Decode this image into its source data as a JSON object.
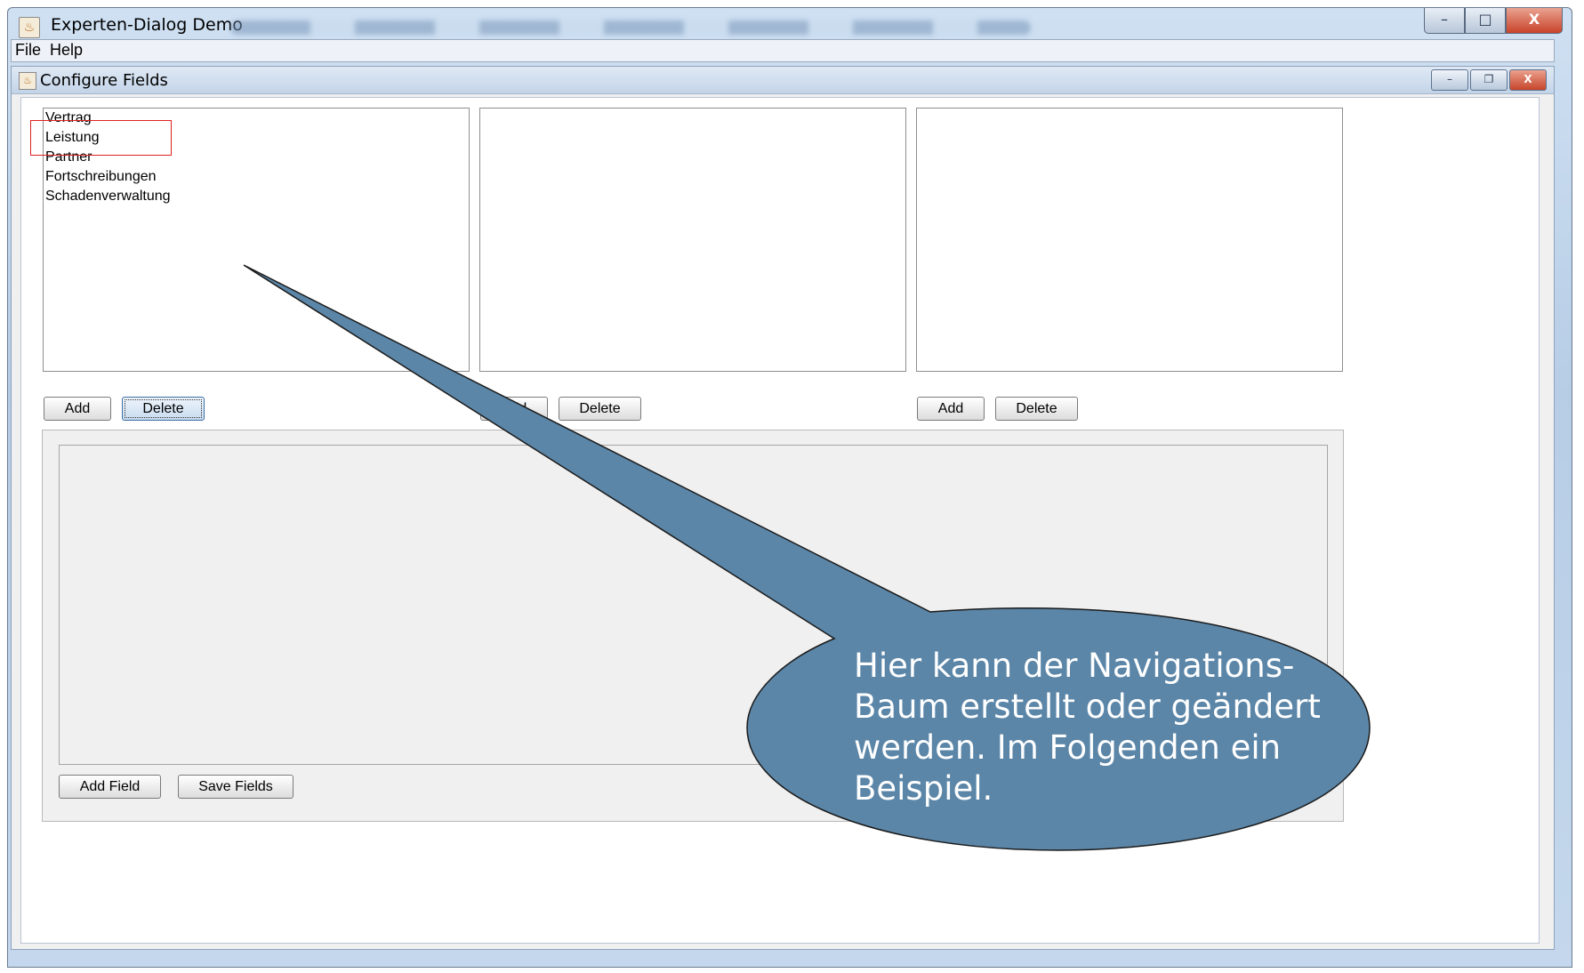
{
  "window": {
    "title": "Experten-Dialog Demo",
    "icon": "java-icon",
    "controls": {
      "minimize": "–",
      "maximize": "□",
      "close": "X"
    }
  },
  "menubar": {
    "items": [
      "File",
      "Help"
    ]
  },
  "internal_frame": {
    "title": "Configure Fields",
    "controls": {
      "minimize": "–",
      "restore": "❐",
      "close": "X"
    }
  },
  "lists": {
    "col1": [
      "Vertrag",
      "Leistung",
      "Partner",
      "Fortschreibungen",
      "Schadenverwaltung"
    ],
    "col2": [],
    "col3": []
  },
  "buttons": {
    "col1_add": "Add",
    "col1_delete": "Delete",
    "col2_add": "Add",
    "col2_delete": "Delete",
    "col3_add": "Add",
    "col3_delete": "Delete",
    "add_field": "Add Field",
    "save_fields": "Save Fields"
  },
  "callout": {
    "text": "Hier kann der Navigations-Baum erstellt oder geändert werden. Im Folgenden ein Beispiel.",
    "fill_color": "#5b86a8"
  },
  "colors": {
    "highlight_box": "#e02020"
  }
}
